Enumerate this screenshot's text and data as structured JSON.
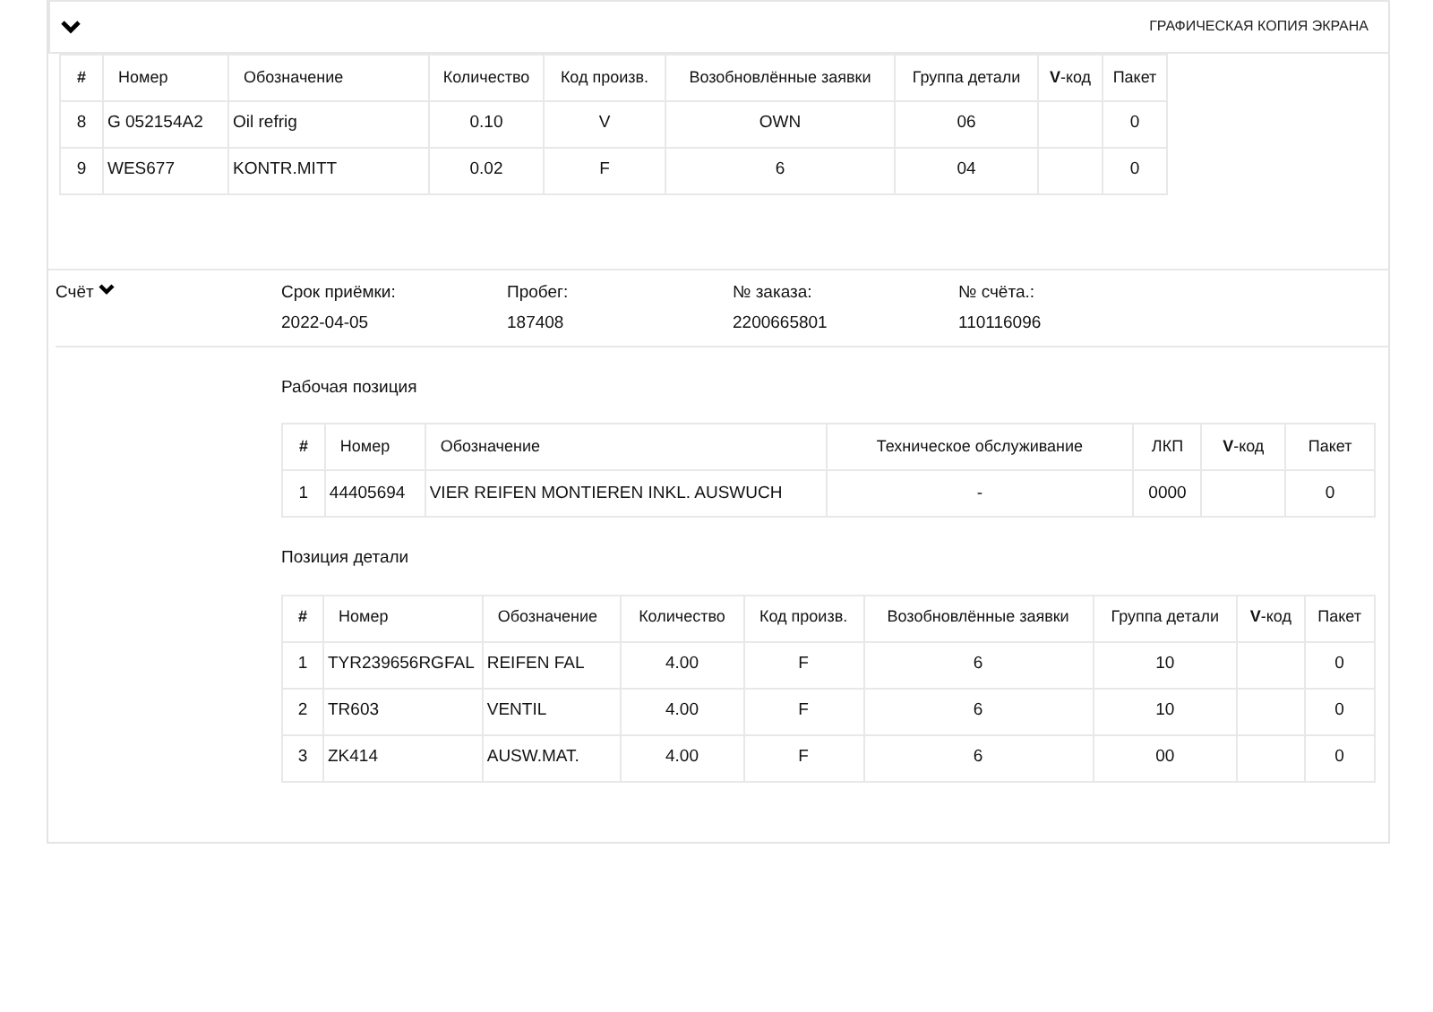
{
  "screen_copy_label": "ГРАФИЧЕСКАЯ КОПИЯ ЭКРАНА",
  "parts_table_top": {
    "columns": [
      "#",
      "Номер",
      "Обозначение",
      "Количество",
      "Код произв.",
      "Возобновлённые заявки",
      "Группа детали",
      "**V**-код",
      "Пакет"
    ],
    "rows": [
      [
        "8",
        "G 052154A2",
        "Oil refrig",
        "0.10",
        "V",
        "OWN",
        "06",
        "",
        "0"
      ],
      [
        "9",
        "WES677",
        "KONTR.MITT",
        "0.02",
        "F",
        "6",
        "04",
        "",
        "0"
      ]
    ]
  },
  "invoice": {
    "label": "Счёт",
    "fields": [
      {
        "label": "Срок приёмки:",
        "value": "2022-04-05"
      },
      {
        "label": "Пробег:",
        "value": "187408"
      },
      {
        "label": "№ заказа:",
        "value": "2200665801"
      },
      {
        "label": "№ счёта.:",
        "value": "110116096"
      }
    ],
    "work_position": {
      "title": "Рабочая позиция",
      "columns": [
        "#",
        "Номер",
        "Обозначение",
        "Техническое обслуживание",
        "ЛКП",
        "**V**-код",
        "Пакет"
      ],
      "rows": [
        [
          "1",
          "44405694",
          "VIER REIFEN MONTIEREN INKL. AUSWUCH",
          "-",
          "0000",
          "",
          "0"
        ]
      ]
    },
    "part_position": {
      "title": "Позиция детали",
      "columns": [
        "#",
        "Номер",
        "Обозначение",
        "Количество",
        "Код произв.",
        "Возобновлённые заявки",
        "Группа детали",
        "**V**-код",
        "Пакет"
      ],
      "rows": [
        [
          "1",
          "TYR239656RGFAL",
          "REIFEN FAL",
          "4.00",
          "F",
          "6",
          "10",
          "",
          "0"
        ],
        [
          "2",
          "TR603",
          "VENTIL",
          "4.00",
          "F",
          "6",
          "10",
          "",
          "0"
        ],
        [
          "3",
          "ZK414",
          "AUSW.MAT.",
          "4.00",
          "F",
          "6",
          "00",
          "",
          "0"
        ]
      ]
    }
  }
}
